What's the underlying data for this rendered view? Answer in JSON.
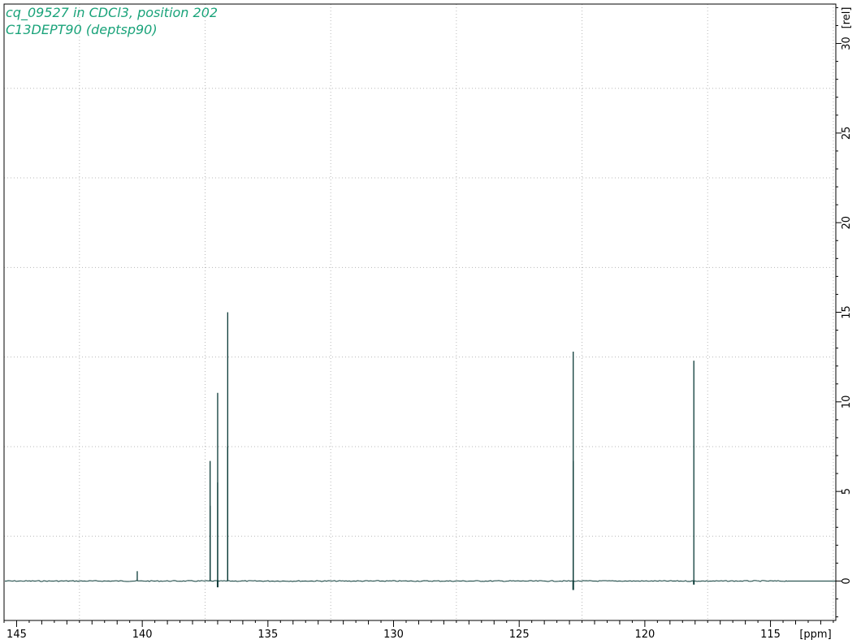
{
  "header": {
    "title_line1": "cq_09527 in CDCl3, position 202",
    "title_line2": "C13DEPT90 (deptsp90)"
  },
  "colors": {
    "title": "#1aa37a",
    "spectrum": "#0a3a37",
    "axis": "#000000",
    "grid": "#b8b8b8",
    "background": "#ffffff"
  },
  "chart_data": {
    "type": "line",
    "xlabel": "[ppm]",
    "ylabel": "[rel]",
    "xlim": [
      145.5,
      112.4
    ],
    "ylim": [
      -2.2,
      32.2
    ],
    "x_reversed": true,
    "grid": true,
    "grid_style": "dotted",
    "x_ticks": [
      145,
      140,
      135,
      130,
      125,
      120,
      115
    ],
    "x_minor_step": 0.5,
    "x_grid": [
      142.5,
      137.5,
      132.5,
      127.5,
      122.5,
      117.5,
      112.5
    ],
    "y_ticks": [
      0,
      5,
      10,
      15,
      20,
      25,
      30
    ],
    "y_minor_step": 1,
    "y_grid": [
      2.5,
      7.5,
      12.5,
      17.5,
      22.5,
      27.5,
      32.5
    ],
    "series": [
      {
        "peaks": [
          {
            "x": 140.2,
            "y": 0.55
          },
          {
            "x": 137.3,
            "y": 6.7
          },
          {
            "x": 137.3,
            "y": 4.2
          },
          {
            "x": 137.0,
            "y": 10.5
          },
          {
            "x": 137.0,
            "y": 5.5
          },
          {
            "x": 136.6,
            "y": 15.0
          },
          {
            "x": 136.6,
            "y": 7.5
          },
          {
            "x": 122.85,
            "y": 12.8
          },
          {
            "x": 122.85,
            "y": 6.7
          },
          {
            "x": 118.05,
            "y": 12.3
          }
        ],
        "dips": [
          {
            "x": 137.0,
            "y": -0.35
          },
          {
            "x": 122.85,
            "y": -0.5
          },
          {
            "x": 118.05,
            "y": -0.2
          }
        ]
      }
    ]
  }
}
